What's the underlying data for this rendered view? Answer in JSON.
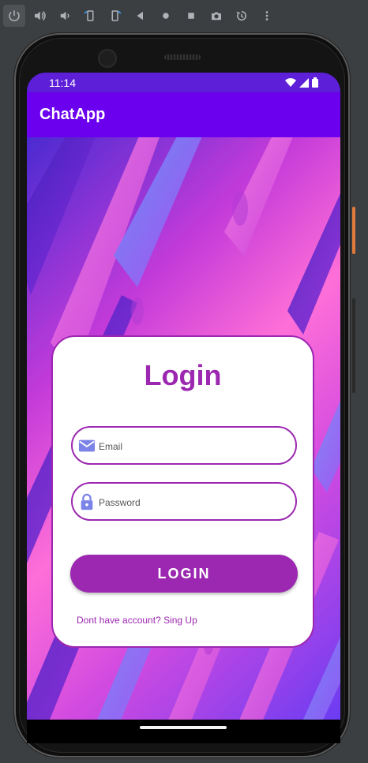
{
  "emulator_toolbar": {
    "icons": [
      "power-icon",
      "volume-up-icon",
      "volume-down-icon",
      "rotate-left-icon",
      "rotate-right-icon",
      "back-icon",
      "home-icon",
      "overview-icon",
      "camera-icon",
      "rewind-icon",
      "more-icon"
    ]
  },
  "status_bar": {
    "time": "11:14"
  },
  "app_bar": {
    "title": "ChatApp"
  },
  "login_card": {
    "title": "Login",
    "email": {
      "placeholder": "Email",
      "value": ""
    },
    "password": {
      "placeholder": "Password",
      "value": ""
    },
    "login_button": "LOGIN",
    "signup_link": "Dont have account? Sing Up"
  },
  "colors": {
    "accent": "#9c27b0",
    "app_bar": "#6a00ee",
    "status_bar": "#5d1fd8"
  }
}
